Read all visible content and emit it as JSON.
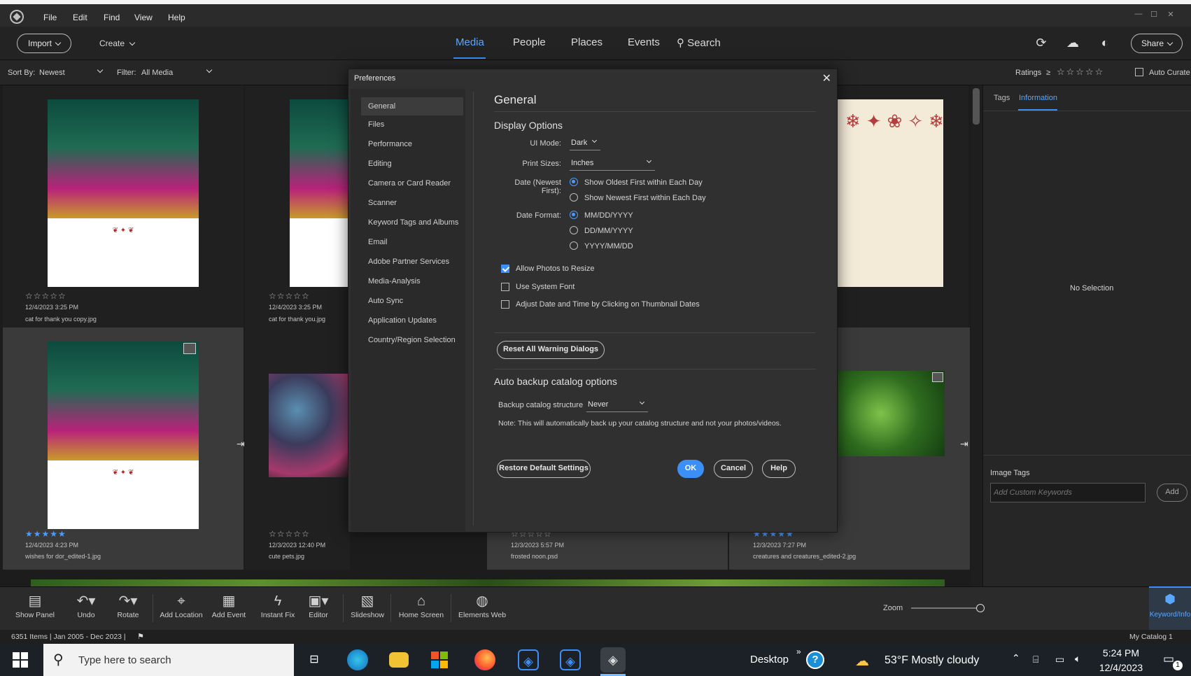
{
  "menubar": {
    "items": [
      "File",
      "Edit",
      "Find",
      "View",
      "Help"
    ]
  },
  "header": {
    "import_label": "Import",
    "create_label": "Create",
    "tabs": [
      "Media",
      "People",
      "Places",
      "Events",
      "Search"
    ],
    "active_tab": "Media",
    "share_label": "Share"
  },
  "sortbar": {
    "sort_label": "Sort By:",
    "sort_value": "Newest",
    "filter_label": "Filter:",
    "filter_value": "All Media",
    "ratings_label": "Ratings",
    "ratings_op": "≥",
    "auto_curate": "Auto Curate"
  },
  "media": [
    {
      "stars": "☆☆☆☆☆",
      "rated": false,
      "date": "12/4/2023 3:25 PM",
      "name": "cat for thank you copy.jpg"
    },
    {
      "stars": "☆☆☆☆☆",
      "rated": false,
      "date": "12/4/2023 3:25 PM",
      "name": "cat for thank you.jpg"
    },
    {
      "stars": "★★★★★",
      "rated": true,
      "date": "12/4/2023 4:23 PM",
      "name": "wishes for dor_edited-1.jpg"
    },
    {
      "stars": "☆☆☆☆☆",
      "rated": false,
      "date": "12/3/2023 12:40 PM",
      "name": "cute pets.jpg"
    },
    {
      "stars": "☆☆☆☆☆",
      "rated": false,
      "date": "12/3/2023 5:57 PM",
      "name": "frosted noon.psd"
    },
    {
      "stars": "★★★★★",
      "rated": true,
      "date": "12/3/2023 7:27 PM",
      "name": "creatures and creatures_edited-2.jpg"
    }
  ],
  "rightpanel": {
    "tabs": [
      "Tags",
      "Information"
    ],
    "no_selection": "No Selection",
    "image_tags_label": "Image Tags",
    "keyword_placeholder": "Add Custom Keywords",
    "add_label": "Add"
  },
  "dialog": {
    "title": "Preferences",
    "categories": [
      "General",
      "Files",
      "Performance",
      "Editing",
      "Camera or Card Reader",
      "Scanner",
      "Keyword Tags and Albums",
      "Email",
      "Adobe Partner Services",
      "Media-Analysis",
      "Auto Sync",
      "Application Updates",
      "Country/Region Selection"
    ],
    "heading": "General",
    "display_options": "Display Options",
    "ui_mode_label": "UI Mode:",
    "ui_mode_value": "Dark",
    "print_sizes_label": "Print Sizes:",
    "print_sizes_value": "Inches",
    "date_label": "Date (Newest First):",
    "date_opt1": "Show Oldest First within Each Day",
    "date_opt2": "Show Newest First within Each Day",
    "date_format_label": "Date Format:",
    "fmt1": "MM/DD/YYYY",
    "fmt2": "DD/MM/YYYY",
    "fmt3": "YYYY/MM/DD",
    "chk1": "Allow Photos to Resize",
    "chk2": "Use System Font",
    "chk3": "Adjust Date and Time by Clicking on Thumbnail Dates",
    "reset_warnings": "Reset All Warning Dialogs",
    "backup_heading": "Auto backup catalog options",
    "backup_label": "Backup catalog structure",
    "backup_value": "Never",
    "note": "Note: This will automatically back up your catalog structure and not your photos/videos.",
    "restore": "Restore Default Settings",
    "ok": "OK",
    "cancel": "Cancel",
    "help": "Help"
  },
  "bottombar": {
    "buttons": [
      "Show Panel",
      "Undo",
      "Rotate",
      "Add Location",
      "Add Event",
      "Instant Fix",
      "Editor",
      "Slideshow",
      "Home Screen",
      "Elements Web"
    ],
    "zoom_label": "Zoom",
    "keyword_info": "Keyword/Info"
  },
  "status": {
    "items": "6351 Items | Jan 2005 - Dec 2023 |",
    "catalog": "My Catalog 1"
  },
  "taskbar": {
    "search_placeholder": "Type here to search",
    "desktop": "Desktop",
    "weather": "53°F  Mostly cloudy",
    "time": "5:24 PM",
    "date": "12/4/2023",
    "notif_count": "1"
  }
}
